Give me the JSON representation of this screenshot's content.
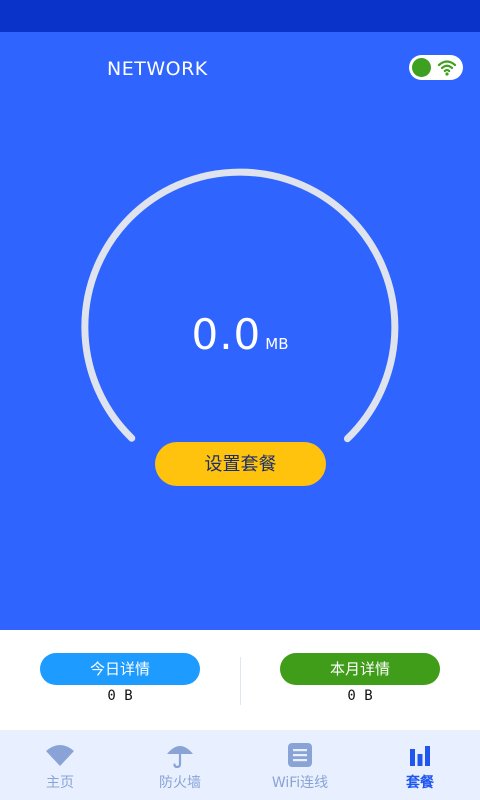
{
  "header": {
    "title": "NETWORK"
  },
  "gauge": {
    "value": "0.0",
    "unit": "MB",
    "fill_fraction": 0
  },
  "plan_button_label": "设置套餐",
  "details": {
    "today": {
      "label": "今日详情",
      "value": "0 B"
    },
    "month": {
      "label": "本月详情",
      "value": "0 B"
    }
  },
  "tabs": [
    {
      "label": "主页",
      "icon": "wifi-icon",
      "active": false
    },
    {
      "label": "防火墙",
      "icon": "umbrella-icon",
      "active": false
    },
    {
      "label": "WiFi连线",
      "icon": "list-icon",
      "active": false
    },
    {
      "label": "套餐",
      "icon": "bar-chart-icon",
      "active": true
    }
  ],
  "colors": {
    "status_bar": "#0a33c9",
    "hero_background": "#2f64ff",
    "plan_button": "#ffc20d",
    "today_pill": "#1e9bff",
    "month_pill": "#3f9d19",
    "tab_active": "#1f56f0",
    "tab_inactive": "#8aa3d6"
  }
}
